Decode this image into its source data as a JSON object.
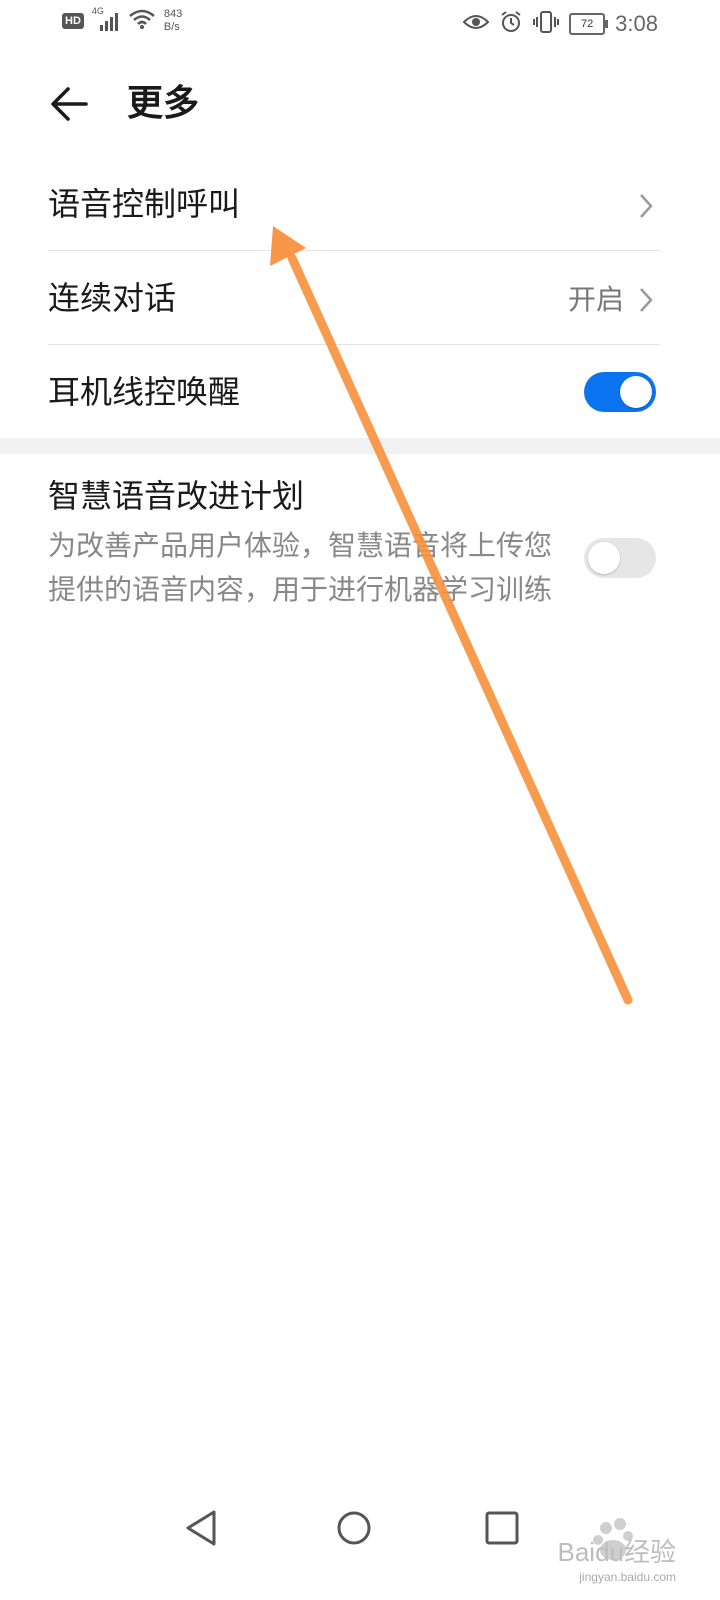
{
  "status_bar": {
    "hd_label": "HD",
    "network_type": "4G",
    "net_speed_value": "843",
    "net_speed_unit": "B/s",
    "battery_level": "72",
    "time": "3:08"
  },
  "header": {
    "title": "更多"
  },
  "settings": {
    "voice_call": {
      "label": "语音控制呼叫"
    },
    "continuous_dialog": {
      "label": "连续对话",
      "value": "开启"
    },
    "headset_wakeup": {
      "label": "耳机线控唤醒",
      "enabled": true
    },
    "improvement_plan": {
      "label": "智慧语音改进计划",
      "description": "为改善产品用户体验，智慧语音将上传您提供的语音内容，用于进行机器学习训练",
      "enabled": false
    }
  },
  "watermark": {
    "brand": "Baidu经验",
    "url": "jingyan.baidu.com"
  },
  "colors": {
    "accent": "#0a74f0",
    "annotation_arrow": "#f7913d"
  }
}
